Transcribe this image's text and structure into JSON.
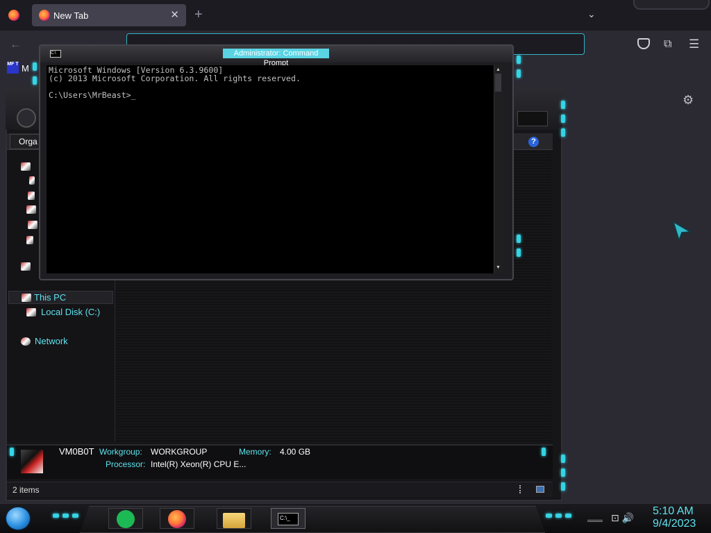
{
  "browser": {
    "tab_title": "New Tab",
    "tab_close": "✕",
    "new_tab": "+",
    "tab_list": "⌄",
    "back": "←",
    "pocket_icon": "pocket-icon",
    "extensions_icon": "puzzle-icon",
    "menu_icon": "☰",
    "bookmark_favicon": "MF T",
    "bookmark_label": "M",
    "settings_icon": "⚙",
    "accent_color": "#35b3c4"
  },
  "cmd": {
    "title": "Administrator: Command Prompt",
    "lines": "Microsoft Windows [Version 6.3.9600]\n(c) 2013 Microsoft Corporation. All rights reserved.\n\nC:\\Users\\MrBeast>_",
    "scroll_up": "▲",
    "scroll_down": "▼"
  },
  "explorer": {
    "organize": "Orga",
    "help": "?",
    "tree": {
      "this_pc": "This PC",
      "local_disk": "Local Disk (C:)",
      "network": "Network"
    },
    "details": {
      "computer_name": "VM0B0T",
      "workgroup_label": "Workgroup:",
      "workgroup_value": "WORKGROUP",
      "memory_label": "Memory:",
      "memory_value": "4.00 GB",
      "processor_label": "Processor:",
      "processor_value": "Intel(R) Xeon(R) CPU E..."
    },
    "status": "2 items"
  },
  "taskbar": {
    "pinned": [
      "spotify",
      "firefox",
      "file-explorer",
      "command-prompt"
    ],
    "cmd_icon_text": "C:\\_",
    "tray": "⊡ 🔊",
    "time": "5:10 AM",
    "date": "9/4/2023",
    "accent_color": "#5fe3ee"
  }
}
